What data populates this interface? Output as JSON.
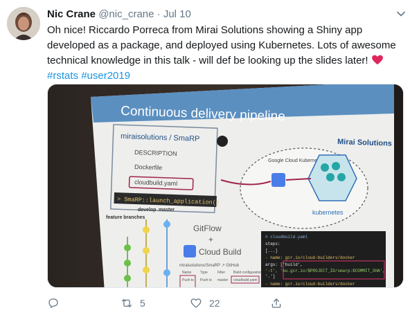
{
  "tweet": {
    "author_name": "Nic Crane",
    "handle": "@nic_crane",
    "separator": "·",
    "date": "Jul 10",
    "text": "Oh nice! Riccardo Porreca from Mirai Solutions showing a Shiny app developed as a package, and deployed using Kubernetes. Lots of awesome technical knowledge in this talk - will def be looking up the slides later!",
    "hashtags": [
      "#rstats",
      "#user2019"
    ]
  },
  "slide": {
    "title": "Continuous delivery pipeline",
    "logo": "Mirai Solutions",
    "repo": "miraisolutions / SmaRP",
    "files": [
      "DESCRIPTION",
      "Dockerfile",
      "cloudbuild.yaml"
    ],
    "command": "> SmaRP::launch_application()",
    "branch_labels": [
      "feature branches",
      "develop",
      "master"
    ],
    "gitflow": "GitFlow",
    "plus": "+",
    "cloud_build": "Cloud Build",
    "gcloud": "Google Cloud Kubernetes Engine",
    "kubernetes": "kubernetes",
    "trigger_title": "miraisolutions/SmaRP ↗ GitHub",
    "trigger_headers": [
      "Name",
      "Type",
      "Filter",
      "Build configuration"
    ],
    "trigger_cells": [
      "Push to",
      "Push to",
      "master",
      "cloudbuild.yaml"
    ],
    "code_lines": [
      "# cloudbuild.yaml",
      "steps:",
      "[...]",
      "- name: gcr.io/cloud-builders/docker",
      "  args: ['build',",
      "    '-t', 'eu.gcr.io/$PROJECT_ID/smarp:$COMMIT_SHA',",
      "    '.']",
      "- name: gcr.io/cloud-builders/docker"
    ]
  },
  "actions": {
    "reply_count": "",
    "retweet_count": "5",
    "like_count": "22"
  },
  "colors": {
    "link": "#1b95e0",
    "meta": "#657786",
    "heart": "#e0245e"
  }
}
